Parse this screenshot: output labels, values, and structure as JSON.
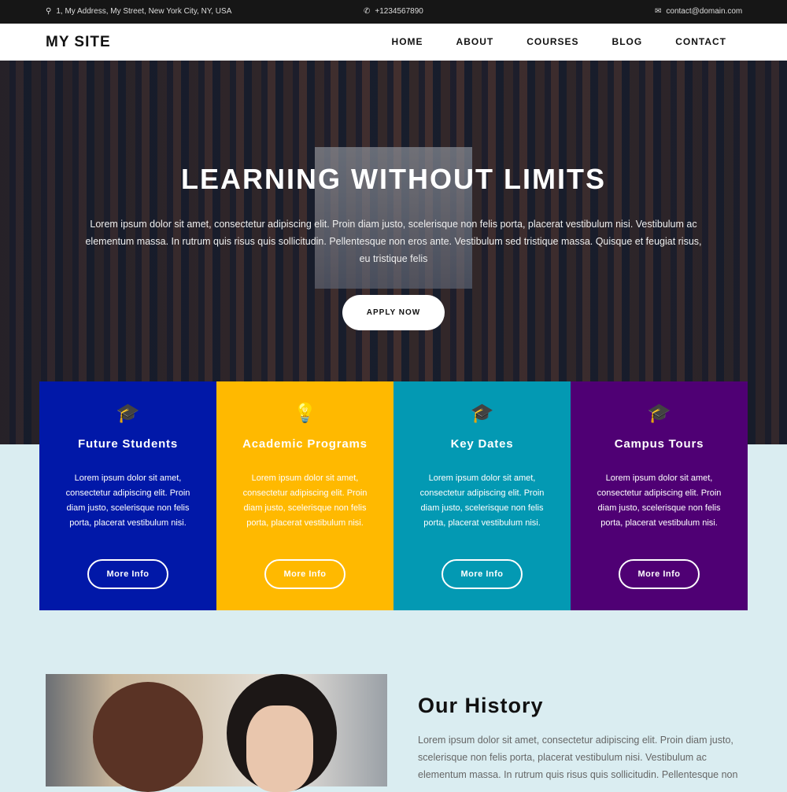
{
  "topbar": {
    "address": "1, My Address, My Street, New York City, NY, USA",
    "phone": "+1234567890",
    "email": "contact@domain.com"
  },
  "nav": {
    "logo": "MY SITE",
    "items": [
      "HOME",
      "ABOUT",
      "COURSES",
      "BLOG",
      "CONTACT"
    ]
  },
  "hero": {
    "title": "LEARNING WITHOUT LIMITS",
    "text": "Lorem ipsum dolor sit amet, consectetur adipiscing elit. Proin diam justo, scelerisque non felis porta, placerat vestibulum nisi. Vestibulum ac elementum massa. In rutrum quis risus quis sollicitudin. Pellentesque non eros ante. Vestibulum sed tristique massa. Quisque et feugiat risus, eu tristique felis",
    "button": "APPLY NOW"
  },
  "cards": [
    {
      "title": "Future Students",
      "icon": "graduate-icon",
      "color": "#0118a8",
      "text": "Lorem ipsum dolor sit amet, consectetur adipiscing elit. Proin diam justo, scelerisque non felis porta, placerat vestibulum nisi.",
      "button": "More Info"
    },
    {
      "title": "Academic Programs",
      "icon": "lightbulb-icon",
      "color": "#ffb900",
      "text": "Lorem ipsum dolor sit amet, consectetur adipiscing elit. Proin diam justo, scelerisque non felis porta, placerat vestibulum nisi.",
      "button": "More Info"
    },
    {
      "title": "Key Dates",
      "icon": "graduate-icon",
      "color": "#0399b3",
      "text": "Lorem ipsum dolor sit amet, consectetur adipiscing elit. Proin diam justo, scelerisque non felis porta, placerat vestibulum nisi.",
      "button": "More Info"
    },
    {
      "title": "Campus Tours",
      "icon": "graduate-icon",
      "color": "#4f0074",
      "text": "Lorem ipsum dolor sit amet, consectetur adipiscing elit. Proin diam justo, scelerisque non felis porta, placerat vestibulum nisi.",
      "button": "More Info"
    }
  ],
  "history": {
    "title": "Our History",
    "text": "Lorem ipsum dolor sit amet, consectetur adipiscing elit. Proin diam justo, scelerisque non felis porta, placerat vestibulum nisi. Vestibulum ac elementum massa. In rutrum quis risus quis sollicitudin. Pellentesque non"
  }
}
